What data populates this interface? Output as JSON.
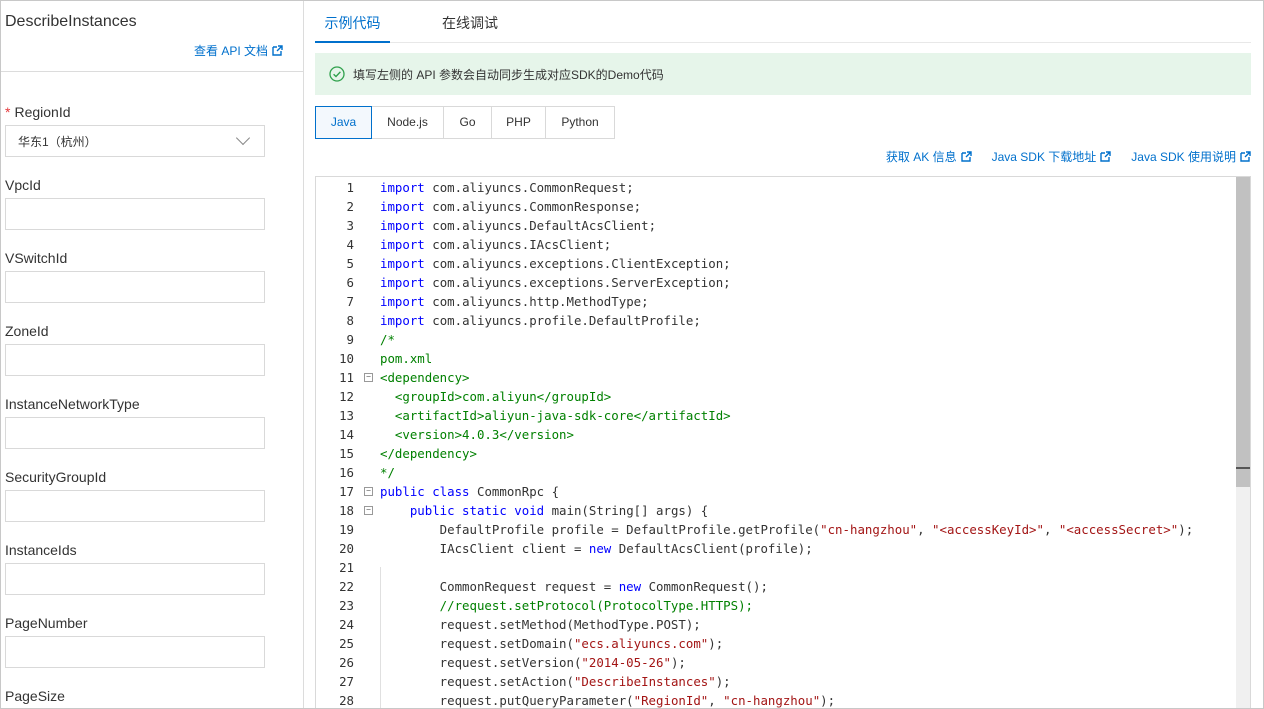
{
  "left": {
    "title": "DescribeInstances",
    "api_doc_link": "查看 API 文档",
    "fields": [
      {
        "label": "RegionId",
        "required": true,
        "type": "select",
        "value": "华东1（杭州）"
      },
      {
        "label": "VpcId",
        "required": false,
        "type": "text",
        "value": ""
      },
      {
        "label": "VSwitchId",
        "required": false,
        "type": "text",
        "value": ""
      },
      {
        "label": "ZoneId",
        "required": false,
        "type": "text",
        "value": ""
      },
      {
        "label": "InstanceNetworkType",
        "required": false,
        "type": "text",
        "value": ""
      },
      {
        "label": "SecurityGroupId",
        "required": false,
        "type": "text",
        "value": ""
      },
      {
        "label": "InstanceIds",
        "required": false,
        "type": "text",
        "value": ""
      },
      {
        "label": "PageNumber",
        "required": false,
        "type": "text",
        "value": ""
      },
      {
        "label": "PageSize",
        "required": false,
        "type": "text",
        "value": ""
      }
    ]
  },
  "right": {
    "tabs": [
      {
        "label": "示例代码",
        "active": true
      },
      {
        "label": "在线调试",
        "active": false
      }
    ],
    "notice": "填写左侧的 API 参数会自动同步生成对应SDK的Demo代码",
    "languages": [
      {
        "label": "Java",
        "active": true
      },
      {
        "label": "Node.js",
        "active": false
      },
      {
        "label": "Go",
        "active": false
      },
      {
        "label": "PHP",
        "active": false
      },
      {
        "label": "Python",
        "active": false
      }
    ],
    "links": [
      {
        "label": "获取 AK 信息"
      },
      {
        "label": "Java SDK 下载地址"
      },
      {
        "label": "Java SDK 使用说明"
      }
    ]
  },
  "code_lines": [
    {
      "n": "1",
      "fold": "",
      "segs": [
        [
          "kw",
          "import"
        ],
        [
          "",
          "com.aliyuncs.CommonRequest;"
        ]
      ]
    },
    {
      "n": "2",
      "fold": "",
      "segs": [
        [
          "kw",
          "import"
        ],
        [
          "",
          "com.aliyuncs.CommonResponse;"
        ]
      ]
    },
    {
      "n": "3",
      "fold": "",
      "segs": [
        [
          "kw",
          "import"
        ],
        [
          "",
          "com.aliyuncs.DefaultAcsClient;"
        ]
      ]
    },
    {
      "n": "4",
      "fold": "",
      "segs": [
        [
          "kw",
          "import"
        ],
        [
          "",
          "com.aliyuncs.IAcsClient;"
        ]
      ]
    },
    {
      "n": "5",
      "fold": "",
      "segs": [
        [
          "kw",
          "import"
        ],
        [
          "",
          "com.aliyuncs.exceptions.ClientException;"
        ]
      ]
    },
    {
      "n": "6",
      "fold": "",
      "segs": [
        [
          "kw",
          "import"
        ],
        [
          "",
          "com.aliyuncs.exceptions.ServerException;"
        ]
      ]
    },
    {
      "n": "7",
      "fold": "",
      "segs": [
        [
          "kw",
          "import"
        ],
        [
          "",
          "com.aliyuncs.http.MethodType;"
        ]
      ]
    },
    {
      "n": "8",
      "fold": "",
      "segs": [
        [
          "kw",
          "import"
        ],
        [
          "",
          "com.aliyuncs.profile.DefaultProfile;"
        ]
      ]
    },
    {
      "n": "9",
      "fold": "",
      "segs": [
        [
          "cm",
          "/*"
        ]
      ]
    },
    {
      "n": "10",
      "fold": "",
      "segs": [
        [
          "cm",
          "pom.xml"
        ]
      ]
    },
    {
      "n": "11",
      "fold": "−",
      "segs": [
        [
          "tag",
          "<dependency>"
        ]
      ]
    },
    {
      "n": "12",
      "fold": "",
      "segs": [
        [
          "tag",
          "  <groupId>com.aliyun</groupId>"
        ]
      ]
    },
    {
      "n": "13",
      "fold": "",
      "segs": [
        [
          "tag",
          "  <artifactId>aliyun-java-sdk-core</artifactId>"
        ]
      ]
    },
    {
      "n": "14",
      "fold": "",
      "segs": [
        [
          "tag",
          "  <version>4.0.3</version>"
        ]
      ]
    },
    {
      "n": "15",
      "fold": "",
      "segs": [
        [
          "tag",
          "</dependency>"
        ]
      ]
    },
    {
      "n": "16",
      "fold": "",
      "segs": [
        [
          "cm",
          "*/"
        ]
      ]
    },
    {
      "n": "17",
      "fold": "−",
      "segs": [
        [
          "kw",
          "public class"
        ],
        [
          "",
          "CommonRpc {"
        ]
      ]
    },
    {
      "n": "18",
      "fold": "−",
      "segs": [
        [
          "",
          "    "
        ],
        [
          "kw",
          "public static void"
        ],
        [
          "",
          "main(String[] args) {"
        ]
      ]
    },
    {
      "n": "19",
      "fold": "",
      "segs": [
        [
          "",
          "        DefaultProfile profile = DefaultProfile.getProfile("
        ],
        [
          "str",
          "\"cn-hangzhou\""
        ],
        [
          "",
          ", "
        ],
        [
          "str",
          "\"<accessKeyId>\""
        ],
        [
          "",
          ", "
        ],
        [
          "str",
          "\"<accessSecret>\""
        ],
        [
          "",
          ");"
        ]
      ]
    },
    {
      "n": "20",
      "fold": "",
      "segs": [
        [
          "",
          "        IAcsClient client = "
        ],
        [
          "kw",
          "new"
        ],
        [
          "",
          "DefaultAcsClient(profile);"
        ]
      ]
    },
    {
      "n": "21",
      "fold": "",
      "segs": [
        [
          "",
          ""
        ]
      ]
    },
    {
      "n": "22",
      "fold": "",
      "segs": [
        [
          "",
          "        CommonRequest request = "
        ],
        [
          "kw",
          "new"
        ],
        [
          "",
          "CommonRequest();"
        ]
      ]
    },
    {
      "n": "23",
      "fold": "",
      "segs": [
        [
          "cm",
          "        //request.setProtocol(ProtocolType.HTTPS);"
        ]
      ]
    },
    {
      "n": "24",
      "fold": "",
      "segs": [
        [
          "",
          "        request.setMethod(MethodType.POST);"
        ]
      ]
    },
    {
      "n": "25",
      "fold": "",
      "segs": [
        [
          "",
          "        request.setDomain("
        ],
        [
          "str",
          "\"ecs.aliyuncs.com\""
        ],
        [
          "",
          ");"
        ]
      ]
    },
    {
      "n": "26",
      "fold": "",
      "segs": [
        [
          "",
          "        request.setVersion("
        ],
        [
          "str",
          "\"2014-05-26\""
        ],
        [
          "",
          ");"
        ]
      ]
    },
    {
      "n": "27",
      "fold": "",
      "segs": [
        [
          "",
          "        request.setAction("
        ],
        [
          "str",
          "\"DescribeInstances\""
        ],
        [
          "",
          ");"
        ]
      ]
    },
    {
      "n": "28",
      "fold": "",
      "segs": [
        [
          "",
          "        request.putQueryParameter("
        ],
        [
          "str",
          "\"RegionId\""
        ],
        [
          "",
          ", "
        ],
        [
          "str",
          "\"cn-hangzhou\""
        ],
        [
          "",
          ");"
        ]
      ]
    }
  ],
  "colors": {
    "accent": "#0070cc",
    "notice_bg": "#e6f5ea",
    "notice_icon": "#2fa14c",
    "required": "#e4393c",
    "keyword": "#0000ff",
    "string": "#a31515",
    "comment": "#008000"
  }
}
